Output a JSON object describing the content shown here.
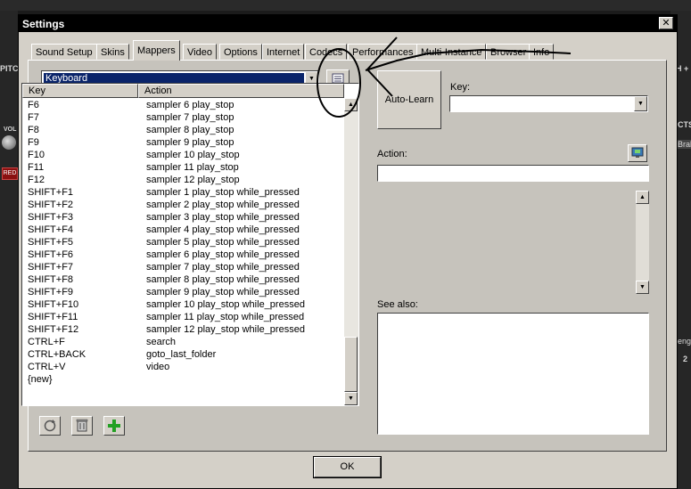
{
  "background": {
    "left_labels": [
      "PITC",
      "VOL",
      "RED"
    ],
    "right_labels": [
      "H +",
      "CTS",
      "Brak",
      "eng",
      "2"
    ]
  },
  "window": {
    "title": "Settings",
    "close_glyph": "✕"
  },
  "tabs": [
    {
      "label": "Sound Setup"
    },
    {
      "label": "Skins"
    },
    {
      "label": "Mappers"
    },
    {
      "label": "Video"
    },
    {
      "label": "Options"
    },
    {
      "label": "Internet"
    },
    {
      "label": "Codecs"
    },
    {
      "label": "Performances"
    },
    {
      "label": "Multi-Instance"
    },
    {
      "label": "Browser"
    },
    {
      "label": "Info"
    }
  ],
  "active_tab": "Mappers",
  "mapper_select": {
    "value": "Keyboard"
  },
  "mapping_list": {
    "columns": [
      "Key",
      "Action"
    ],
    "rows": [
      {
        "key": "F6",
        "action": "sampler  6 play_stop"
      },
      {
        "key": "F7",
        "action": "sampler  7 play_stop"
      },
      {
        "key": "F8",
        "action": "sampler  8 play_stop"
      },
      {
        "key": "F9",
        "action": "sampler  9 play_stop"
      },
      {
        "key": "F10",
        "action": "sampler  10 play_stop"
      },
      {
        "key": "F11",
        "action": "sampler  11 play_stop"
      },
      {
        "key": "F12",
        "action": "sampler  12 play_stop"
      },
      {
        "key": "SHIFT+F1",
        "action": "sampler  1 play_stop while_pressed"
      },
      {
        "key": "SHIFT+F2",
        "action": "sampler  2 play_stop while_pressed"
      },
      {
        "key": "SHIFT+F3",
        "action": "sampler  3 play_stop while_pressed"
      },
      {
        "key": "SHIFT+F4",
        "action": "sampler  4 play_stop while_pressed"
      },
      {
        "key": "SHIFT+F5",
        "action": "sampler  5 play_stop while_pressed"
      },
      {
        "key": "SHIFT+F6",
        "action": "sampler  6 play_stop while_pressed"
      },
      {
        "key": "SHIFT+F7",
        "action": "sampler  7 play_stop while_pressed"
      },
      {
        "key": "SHIFT+F8",
        "action": "sampler  8 play_stop while_pressed"
      },
      {
        "key": "SHIFT+F9",
        "action": "sampler  9 play_stop while_pressed"
      },
      {
        "key": "SHIFT+F10",
        "action": "sampler  10 play_stop while_pressed"
      },
      {
        "key": "SHIFT+F11",
        "action": "sampler  11 play_stop while_pressed"
      },
      {
        "key": "SHIFT+F12",
        "action": "sampler  12 play_stop while_pressed"
      },
      {
        "key": "CTRL+F",
        "action": "search"
      },
      {
        "key": "CTRL+BACK",
        "action": "goto_last_folder"
      },
      {
        "key": "CTRL+V",
        "action": "video"
      },
      {
        "key": "{new}",
        "action": ""
      }
    ]
  },
  "auto_learn": {
    "label": "Auto-Learn"
  },
  "key_field": {
    "label": "Key:",
    "value": ""
  },
  "action_field": {
    "label": "Action:",
    "value": ""
  },
  "see_also": {
    "label": "See also:"
  },
  "ok_button": {
    "label": "OK"
  },
  "icons": {
    "options_button": "list-icon",
    "action_help": "monitor-icon",
    "reload": "reload-icon",
    "delete": "trash-icon",
    "add": "plus-icon"
  },
  "colors": {
    "selection": "#0a246a",
    "dialog_bg": "#d4d0c8",
    "titlebar": "#000000",
    "add_icon": "#22a022"
  }
}
